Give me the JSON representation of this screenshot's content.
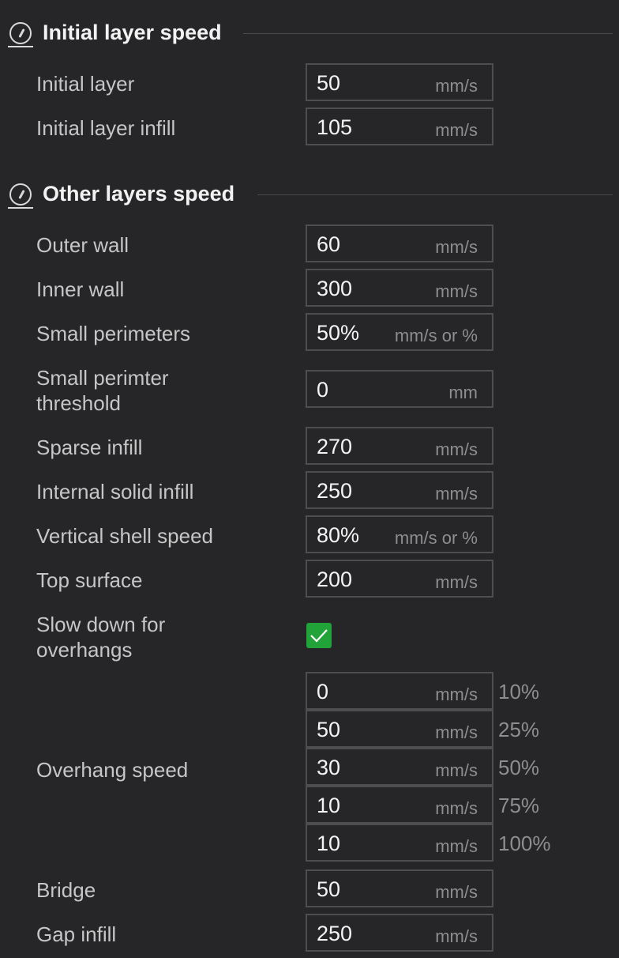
{
  "sections": {
    "initial": {
      "title": "Initial layer speed"
    },
    "other": {
      "title": "Other layers speed"
    }
  },
  "fields": {
    "initial_layer": {
      "label": "Initial layer",
      "value": "50",
      "unit": "mm/s"
    },
    "initial_layer_infill": {
      "label": "Initial layer infill",
      "value": "105",
      "unit": "mm/s"
    },
    "outer_wall": {
      "label": "Outer wall",
      "value": "60",
      "unit": "mm/s"
    },
    "inner_wall": {
      "label": "Inner wall",
      "value": "300",
      "unit": "mm/s"
    },
    "small_perimeters": {
      "label": "Small perimeters",
      "value": "50%",
      "unit": "mm/s or %"
    },
    "small_perimeter_threshold": {
      "label_line1": "Small perimter",
      "label_line2": "threshold",
      "value": "0",
      "unit": "mm"
    },
    "sparse_infill": {
      "label": "Sparse infill",
      "value": "270",
      "unit": "mm/s"
    },
    "internal_solid_infill": {
      "label": "Internal solid infill",
      "value": "250",
      "unit": "mm/s"
    },
    "vertical_shell_speed": {
      "label": "Vertical shell speed",
      "value": "80%",
      "unit": "mm/s or %"
    },
    "top_surface": {
      "label": "Top surface",
      "value": "200",
      "unit": "mm/s"
    },
    "slow_down_overhangs": {
      "label_line1": "Slow down for",
      "label_line2": "overhangs",
      "checked": true
    },
    "overhang_speed": {
      "label": "Overhang speed",
      "levels": [
        {
          "value": "0",
          "unit": "mm/s",
          "pct": "10%"
        },
        {
          "value": "50",
          "unit": "mm/s",
          "pct": "25%"
        },
        {
          "value": "30",
          "unit": "mm/s",
          "pct": "50%"
        },
        {
          "value": "10",
          "unit": "mm/s",
          "pct": "75%"
        },
        {
          "value": "10",
          "unit": "mm/s",
          "pct": "100%"
        }
      ]
    },
    "bridge": {
      "label": "Bridge",
      "value": "50",
      "unit": "mm/s"
    },
    "gap_infill": {
      "label": "Gap infill",
      "value": "250",
      "unit": "mm/s"
    }
  },
  "colors": {
    "checkbox": "#22a33a",
    "background": "#262628"
  }
}
